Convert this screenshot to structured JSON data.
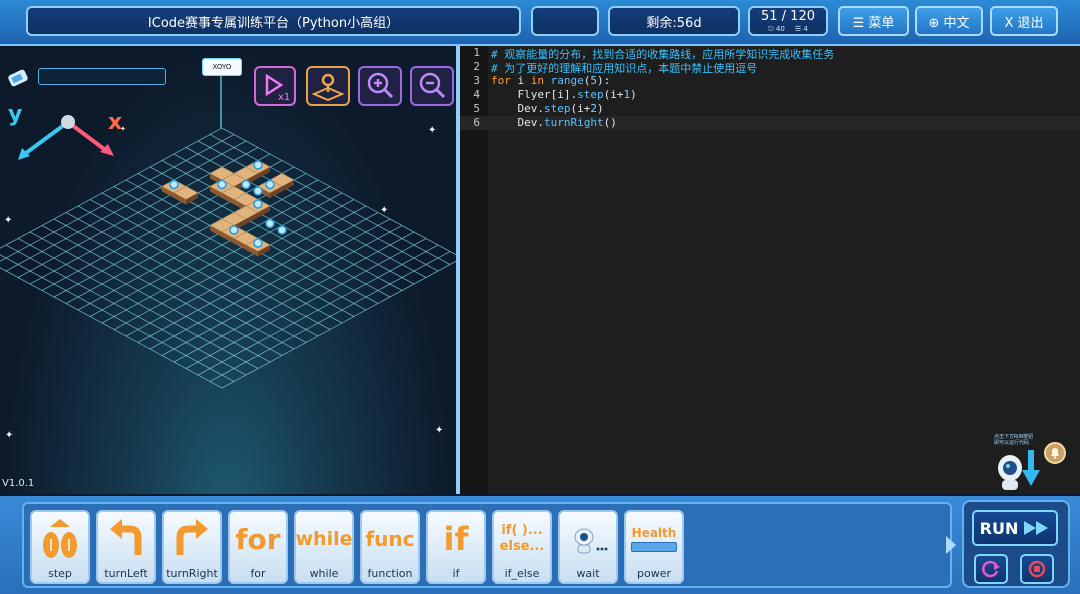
{
  "header": {
    "title": "ICode赛事专属训练平台（Python小高组）",
    "remaining": "剩余:56d",
    "progress": "51 / 120",
    "progress_sub_a": "⎋ 40",
    "progress_sub_b": "☰ 4",
    "menu_label": "☰ 菜单",
    "lang_label": "⊕ 中文",
    "exit_label": "X 退出"
  },
  "game": {
    "version": "V1.0.1",
    "axis_y": "y",
    "axis_x": "x",
    "marker_label": "XOYO",
    "hint_text": "点击下方RUN按钮\n即可以运行代码"
  },
  "editor": {
    "lines": [
      {
        "n": "1",
        "text": "# 观察能量的分布，找到合适的收集路线，应用所学知识完成收集任务"
      },
      {
        "n": "2",
        "text": "# 为了更好的理解和应用知识点，本题中禁止使用逗号"
      },
      {
        "n": "3",
        "text": "for i in range(5):"
      },
      {
        "n": "4",
        "text": "    Flyer[i].step(i+1)"
      },
      {
        "n": "5",
        "text": "    Dev.step(i+2)"
      },
      {
        "n": "6",
        "text": "    Dev.turnRight()"
      }
    ]
  },
  "blocks": [
    {
      "label": "step",
      "icon": "step-icon"
    },
    {
      "label": "turnLeft",
      "icon": "turn-left-icon"
    },
    {
      "label": "turnRight",
      "icon": "turn-right-icon"
    },
    {
      "label": "for",
      "icon_text": "for"
    },
    {
      "label": "while",
      "icon_text": "while"
    },
    {
      "label": "function",
      "icon_text": "func"
    },
    {
      "label": "if",
      "icon_text": "if"
    },
    {
      "label": "if_else",
      "icon_text_a": "if( )...",
      "icon_text_b": "else..."
    },
    {
      "label": "wait",
      "icon": "robot-wait-icon"
    },
    {
      "label": "power",
      "icon_text": "Health"
    }
  ],
  "run": {
    "label": "RUN"
  },
  "colors": {
    "accent": "#2d8bd6",
    "block_orange": "#f29a2e",
    "comment": "#36c3ff"
  }
}
